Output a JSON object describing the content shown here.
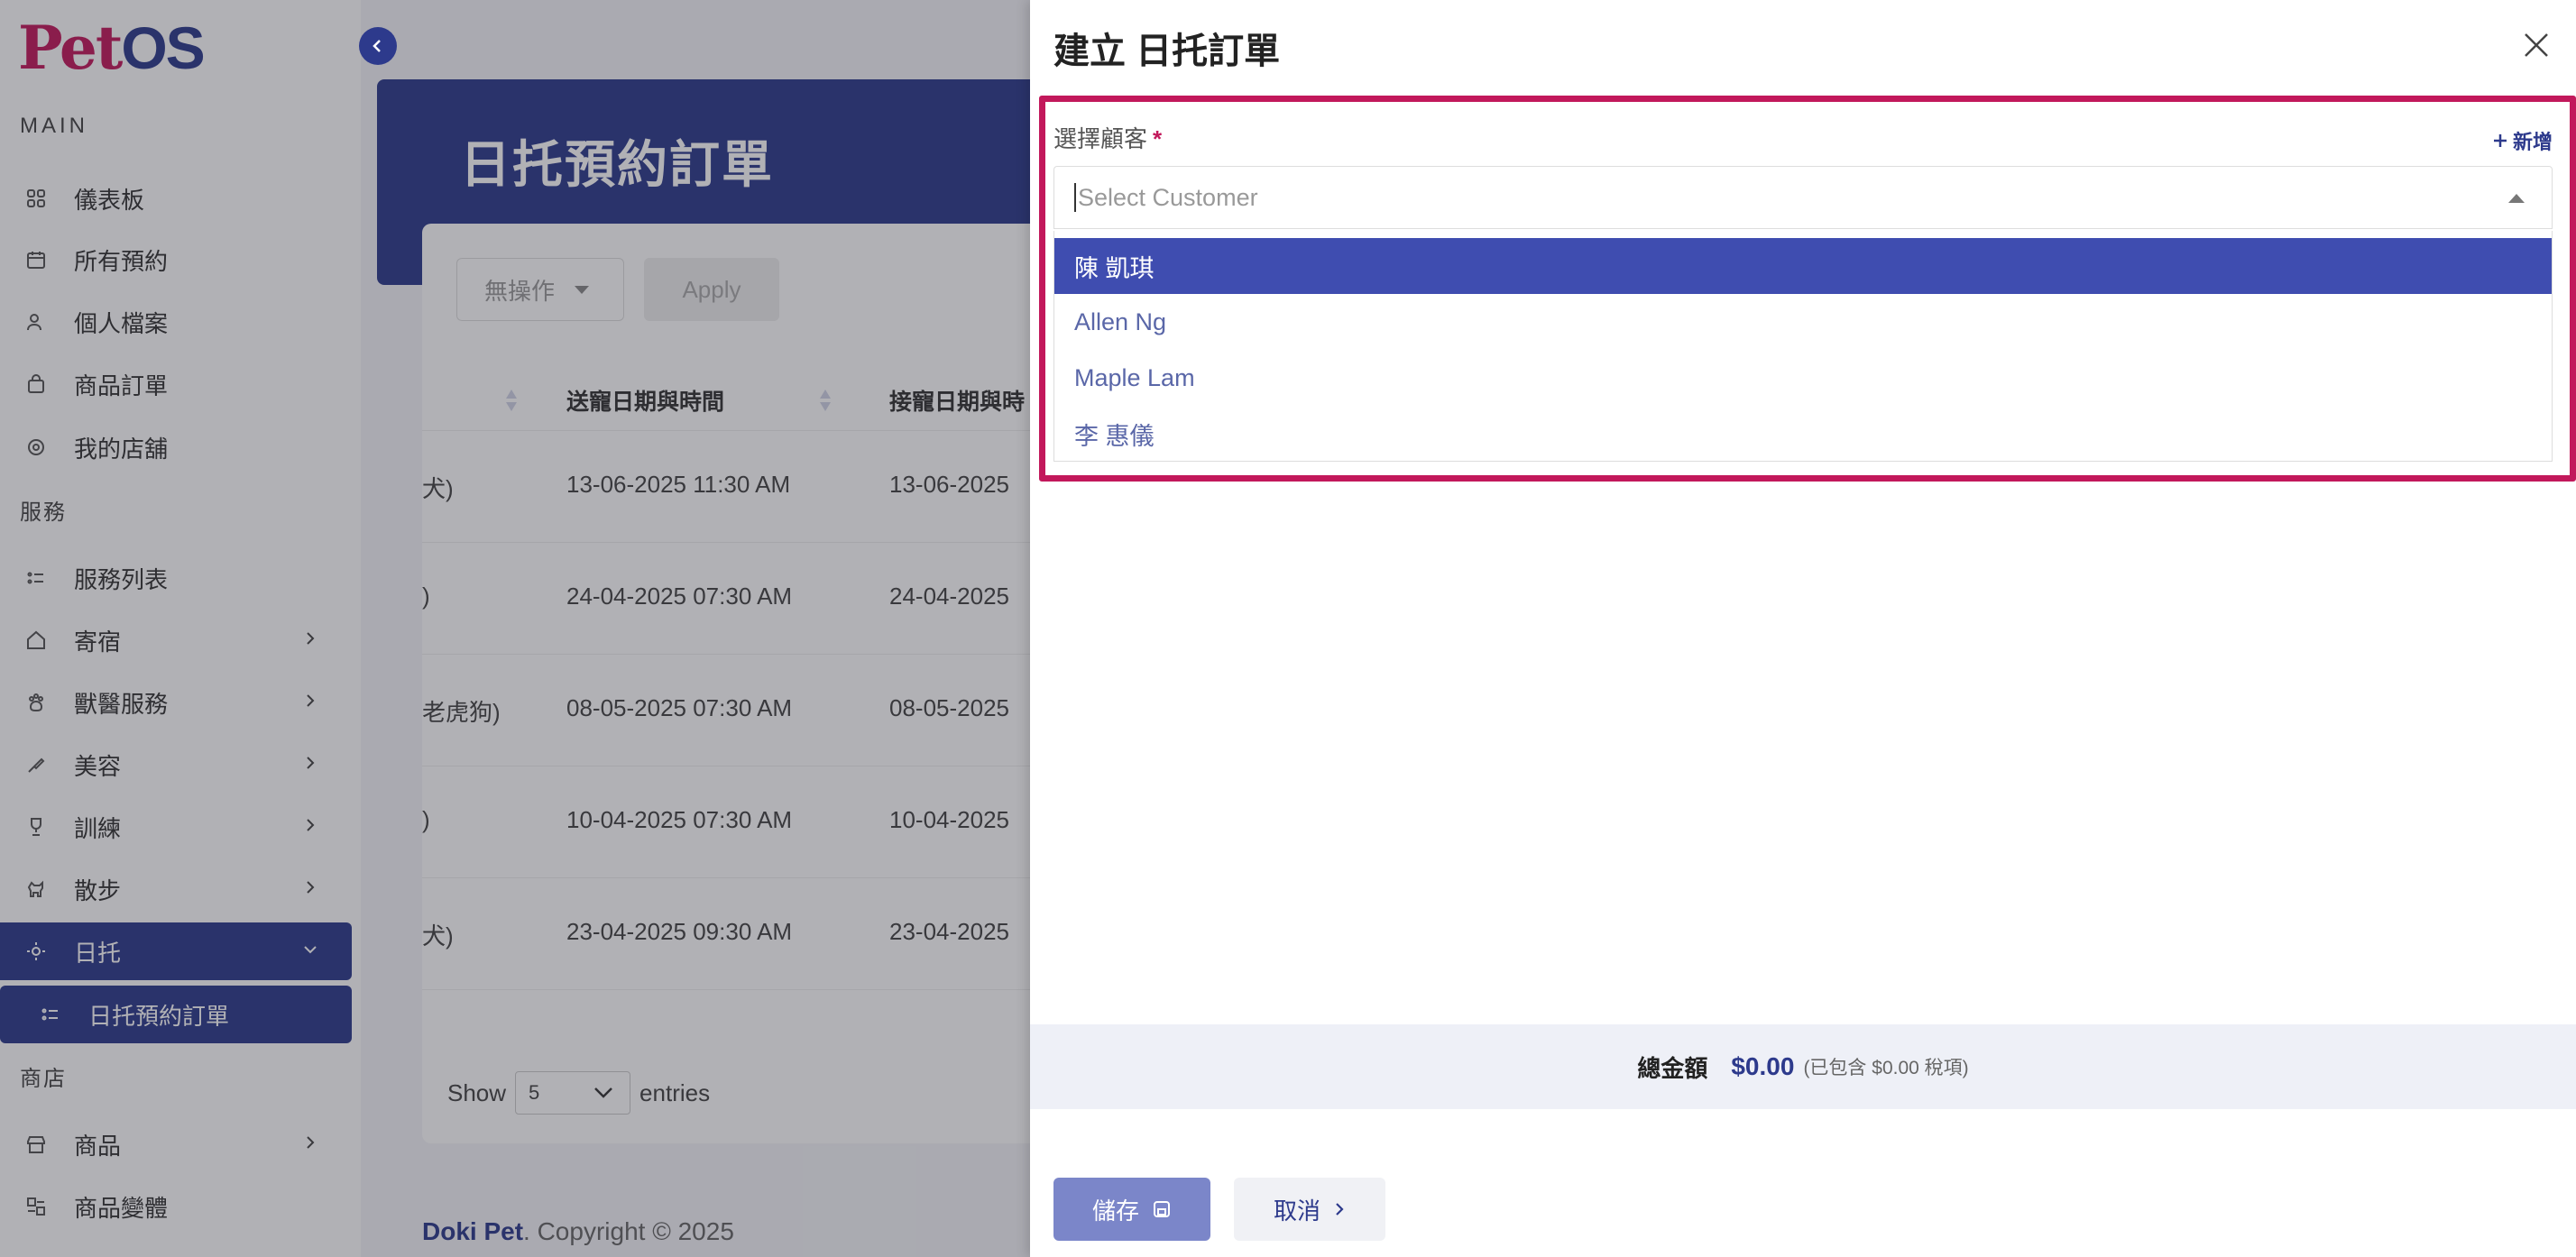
{
  "brand": {
    "logo_pet": "Pet",
    "logo_os": "OS",
    "primary": "#2d3a8c",
    "accent": "#c2185b"
  },
  "sidebar": {
    "sections": {
      "main": "MAIN",
      "services": "服務",
      "shop": "商店"
    },
    "items": [
      {
        "label": "儀表板",
        "icon": "grid-icon"
      },
      {
        "label": "所有預約",
        "icon": "calendar-icon"
      },
      {
        "label": "個人檔案",
        "icon": "user-icon"
      },
      {
        "label": "商品訂單",
        "icon": "bag-icon"
      },
      {
        "label": "我的店舖",
        "icon": "gear-icon"
      },
      {
        "label": "服務列表",
        "icon": "list-icon"
      },
      {
        "label": "寄宿",
        "icon": "home-icon"
      },
      {
        "label": "獸醫服務",
        "icon": "paw-icon"
      },
      {
        "label": "美容",
        "icon": "brush-icon"
      },
      {
        "label": "訓練",
        "icon": "trophy-icon"
      },
      {
        "label": "散步",
        "icon": "dog-icon"
      },
      {
        "label": "日托",
        "icon": "sun-icon"
      },
      {
        "label": "日托預約訂單",
        "icon": "list-icon"
      },
      {
        "label": "商品",
        "icon": "store-icon"
      },
      {
        "label": "商品變體",
        "icon": "variants-icon"
      }
    ]
  },
  "main": {
    "page_title": "日托預約訂單",
    "bulk_action": "無操作",
    "apply": "Apply",
    "columns": [
      "送寵日期與時間",
      "接寵日期與時"
    ],
    "rows": [
      {
        "c0": "犬)",
        "c1": "13-06-2025 11:30 AM",
        "c2": "13-06-2025"
      },
      {
        "c0": ")",
        "c1": "24-04-2025 07:30 AM",
        "c2": "24-04-2025"
      },
      {
        "c0": "老虎狗)",
        "c1": "08-05-2025 07:30 AM",
        "c2": "08-05-2025"
      },
      {
        "c0": ")",
        "c1": "10-04-2025 07:30 AM",
        "c2": "10-04-2025"
      },
      {
        "c0": "犬)",
        "c1": "23-04-2025 09:30 AM",
        "c2": "23-04-2025"
      }
    ],
    "show_label": "Show",
    "entries_value": "5",
    "entries_label": "entries",
    "copyright_brand": "Doki Pet",
    "copyright_text": ". Copyright © 2025"
  },
  "drawer": {
    "title": "建立 日托訂單",
    "customer_label": "選擇顧客",
    "required_mark": "*",
    "add_new": "新增",
    "placeholder": "Select Customer",
    "options": [
      "陳 凱琪",
      "Allen Ng",
      "Maple Lam",
      "李 惠儀"
    ],
    "total_label": "總金額",
    "total_value": "$0.00",
    "tax_note": "(已包含 $0.00 稅項)",
    "save": "儲存",
    "cancel": "取消"
  }
}
